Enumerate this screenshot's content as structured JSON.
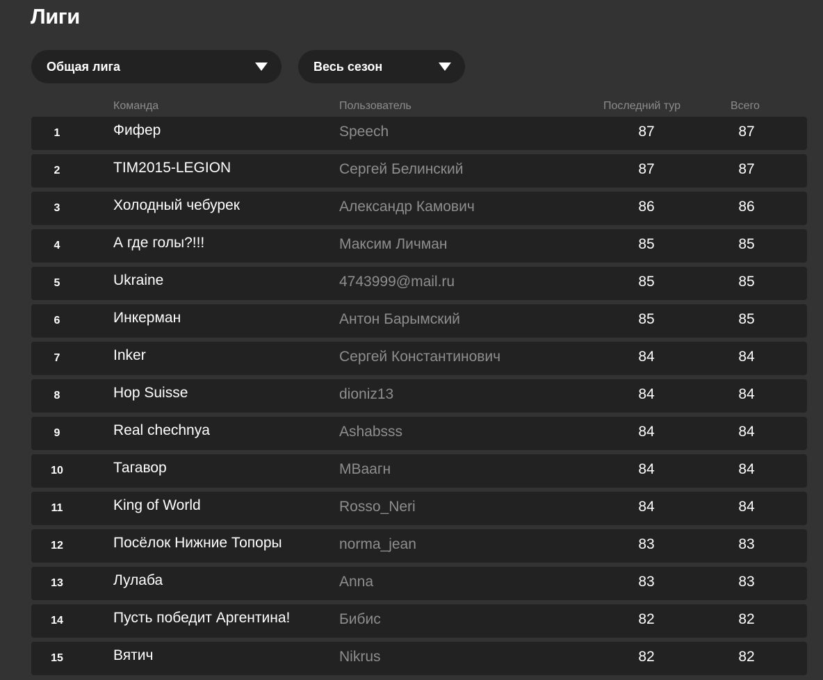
{
  "page": {
    "title": "Лиги"
  },
  "filters": {
    "league": {
      "value": "Общая лига"
    },
    "period": {
      "value": "Весь сезон"
    }
  },
  "table": {
    "headers": {
      "team": "Команда",
      "user": "Пользователь",
      "last_round": "Последний тур",
      "total": "Всего"
    },
    "rows": [
      {
        "rank": "1",
        "team": "Фифер",
        "user": "Speech",
        "last": "87",
        "total": "87"
      },
      {
        "rank": "2",
        "team": "TIM2015-LEGION",
        "user": "Сергей Белинский",
        "last": "87",
        "total": "87"
      },
      {
        "rank": "3",
        "team": "Холодный чебурек",
        "user": "Александр Камович",
        "last": "86",
        "total": "86"
      },
      {
        "rank": "4",
        "team": "А где голы?!!!",
        "user": "Максим Личман",
        "last": "85",
        "total": "85"
      },
      {
        "rank": "5",
        "team": "Ukraine",
        "user": "4743999@mail.ru",
        "last": "85",
        "total": "85"
      },
      {
        "rank": "6",
        "team": "Инкерман",
        "user": "Антон Барымский",
        "last": "85",
        "total": "85"
      },
      {
        "rank": "7",
        "team": "Inker",
        "user": "Сергей Константинович",
        "last": "84",
        "total": "84"
      },
      {
        "rank": "8",
        "team": "Hop Suisse",
        "user": "dioniz13",
        "last": "84",
        "total": "84"
      },
      {
        "rank": "9",
        "team": "Real chechnya",
        "user": "Ashabsss",
        "last": "84",
        "total": "84"
      },
      {
        "rank": "10",
        "team": "Тагавор",
        "user": "MBаагн",
        "last": "84",
        "total": "84"
      },
      {
        "rank": "11",
        "team": "King of World",
        "user": "Rosso_Neri",
        "last": "84",
        "total": "84"
      },
      {
        "rank": "12",
        "team": "Посёлок Нижние Топоры",
        "user": "norma_jean",
        "last": "83",
        "total": "83"
      },
      {
        "rank": "13",
        "team": "Лулаба",
        "user": "Anna",
        "last": "83",
        "total": "83"
      },
      {
        "rank": "14",
        "team": "Пусть победит Аргентина!",
        "user": "Бибис",
        "last": "82",
        "total": "82"
      },
      {
        "rank": "15",
        "team": "Вятич",
        "user": "Nikrus",
        "last": "82",
        "total": "82"
      }
    ]
  }
}
